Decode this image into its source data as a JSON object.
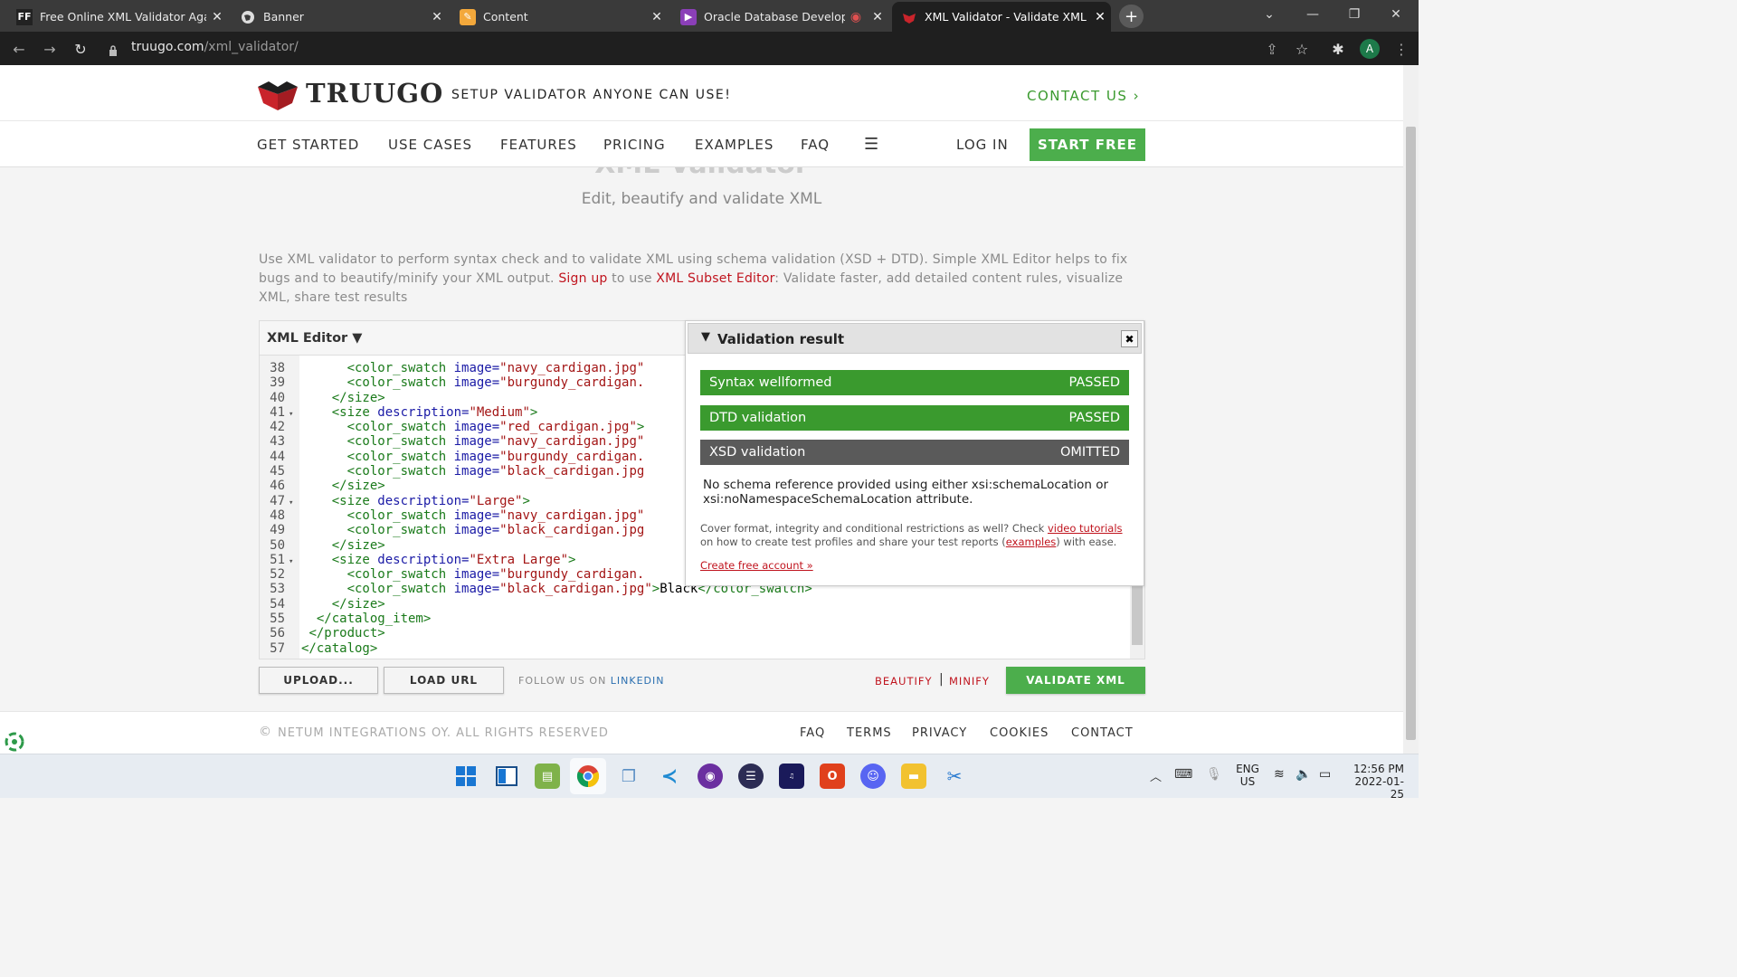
{
  "browser": {
    "tabs": [
      {
        "title": "Free Online XML Validator Again",
        "icon": "FF"
      },
      {
        "title": "Banner",
        "icon": "globe"
      },
      {
        "title": "Content",
        "icon": "pencil"
      },
      {
        "title": "Oracle Database Developme",
        "icon": "oracle"
      },
      {
        "title": "XML Validator - Validate XML On",
        "icon": "truugo"
      }
    ],
    "url_host": "truugo.com",
    "url_path": "/xml_validator/",
    "profile_initial": "A"
  },
  "header": {
    "brand": "TRUUGO",
    "tagline": "SETUP VALIDATOR ANYONE CAN USE!",
    "contact": "CONTACT US ›"
  },
  "nav": {
    "items": [
      "GET STARTED",
      "USE CASES",
      "FEATURES",
      "PRICING",
      "EXAMPLES",
      "FAQ"
    ],
    "login": "LOG IN",
    "start_free": "START FREE"
  },
  "hero": {
    "title": "XML Validator",
    "subtitle": "Edit, beautify and validate XML"
  },
  "intro": {
    "part1": "Use XML validator to perform syntax check and to validate XML using schema validation (XSD + DTD). Simple XML Editor helps to fix bugs and to beautify/minify your XML output. ",
    "signup": "Sign up",
    "part2": " to use ",
    "subset_editor": "XML Subset Editor",
    "part3": ": Validate faster, add detailed content rules, visualize XML, share test results"
  },
  "editor": {
    "title": "XML Editor ▼",
    "lines": [
      {
        "n": "38",
        "f": "",
        "i": "      ",
        "t": "<color_swatch",
        "a": " image=",
        "v": "\"navy_cardigan.jpg\"",
        "r": ""
      },
      {
        "n": "39",
        "f": "",
        "i": "      ",
        "t": "<color_swatch",
        "a": " image=",
        "v": "\"burgundy_cardigan.",
        "r": ""
      },
      {
        "n": "40",
        "f": "",
        "i": "    ",
        "t": "</size>",
        "a": "",
        "v": "",
        "r": ""
      },
      {
        "n": "41",
        "f": "▾",
        "i": "    ",
        "t": "<size",
        "a": " description=",
        "v": "\"Medium\"",
        "t2": ">",
        "r": ""
      },
      {
        "n": "42",
        "f": "",
        "i": "      ",
        "t": "<color_swatch",
        "a": " image=",
        "v": "\"red_cardigan.jpg\"",
        "t2": ">",
        "r": ""
      },
      {
        "n": "43",
        "f": "",
        "i": "      ",
        "t": "<color_swatch",
        "a": " image=",
        "v": "\"navy_cardigan.jpg\"",
        "r": ""
      },
      {
        "n": "44",
        "f": "",
        "i": "      ",
        "t": "<color_swatch",
        "a": " image=",
        "v": "\"burgundy_cardigan.",
        "r": ""
      },
      {
        "n": "45",
        "f": "",
        "i": "      ",
        "t": "<color_swatch",
        "a": " image=",
        "v": "\"black_cardigan.jpg",
        "r": ""
      },
      {
        "n": "46",
        "f": "",
        "i": "    ",
        "t": "</size>",
        "a": "",
        "v": "",
        "r": ""
      },
      {
        "n": "47",
        "f": "▾",
        "i": "    ",
        "t": "<size",
        "a": " description=",
        "v": "\"Large\"",
        "t2": ">",
        "r": ""
      },
      {
        "n": "48",
        "f": "",
        "i": "      ",
        "t": "<color_swatch",
        "a": " image=",
        "v": "\"navy_cardigan.jpg\"",
        "r": ""
      },
      {
        "n": "49",
        "f": "",
        "i": "      ",
        "t": "<color_swatch",
        "a": " image=",
        "v": "\"black_cardigan.jpg",
        "r": ""
      },
      {
        "n": "50",
        "f": "",
        "i": "    ",
        "t": "</size>",
        "a": "",
        "v": "",
        "r": ""
      },
      {
        "n": "51",
        "f": "▾",
        "i": "    ",
        "t": "<size",
        "a": " description=",
        "v": "\"Extra Large\"",
        "t2": ">",
        "r": ""
      },
      {
        "n": "52",
        "f": "",
        "i": "      ",
        "t": "<color_swatch",
        "a": " image=",
        "v": "\"burgundy_cardigan.",
        "r": ""
      },
      {
        "n": "53",
        "f": "",
        "i": "      ",
        "t": "<color_swatch",
        "a": " image=",
        "v": "\"black_cardigan.jpg\"",
        "t2": ">",
        "r": "Black",
        "t3": "</color_swatch>"
      },
      {
        "n": "54",
        "f": "",
        "i": "    ",
        "t": "</size>",
        "a": "",
        "v": "",
        "r": ""
      },
      {
        "n": "55",
        "f": "",
        "i": "  ",
        "t": "</catalog_item>",
        "a": "",
        "v": "",
        "r": ""
      },
      {
        "n": "56",
        "f": "",
        "i": " ",
        "t": "</product>",
        "a": "",
        "v": "",
        "r": ""
      },
      {
        "n": "57",
        "f": "",
        "i": "",
        "t": "</catalog>",
        "a": "",
        "v": "",
        "r": ""
      }
    ]
  },
  "validation": {
    "title": "Validation result",
    "results": [
      {
        "label": "Syntax wellformed",
        "status": "PASSED",
        "color": "#3a9a2e"
      },
      {
        "label": "DTD validation",
        "status": "PASSED",
        "color": "#3a9a2e"
      },
      {
        "label": "XSD validation",
        "status": "OMITTED",
        "color": "#5a5a5a"
      }
    ],
    "message": "No schema reference provided using either xsi:schemaLocation or xsi:noNamespaceSchemaLocation attribute.",
    "promo_1": "Cover format, integrity and conditional restrictions as well? Check ",
    "promo_link1": "video tutorials",
    "promo_2": "on how to create test profiles and share your test reports (",
    "promo_link2": "examples",
    "promo_3": ") with ease.",
    "create_account": "Create free account »"
  },
  "actions": {
    "upload": "UPLOAD...",
    "load_url": "LOAD URL",
    "follow": "FOLLOW US ON ",
    "linkedin": "LINKEDIN",
    "beautify": "BEAUTIFY",
    "minify": "MINIFY",
    "validate": "VALIDATE XML"
  },
  "footer": {
    "copyright": "NETUM INTEGRATIONS OY. ALL RIGHTS RESERVED",
    "links": [
      "FAQ",
      "TERMS",
      "PRIVACY",
      "COOKIES",
      "CONTACT"
    ]
  },
  "taskbar": {
    "lang": "ENG",
    "region": "US",
    "time": "12:56 PM",
    "date": "2022-01-25"
  },
  "colors": {
    "brand_red": "#c9242b",
    "green": "#4cae4c",
    "link_red": "#c0141e"
  }
}
